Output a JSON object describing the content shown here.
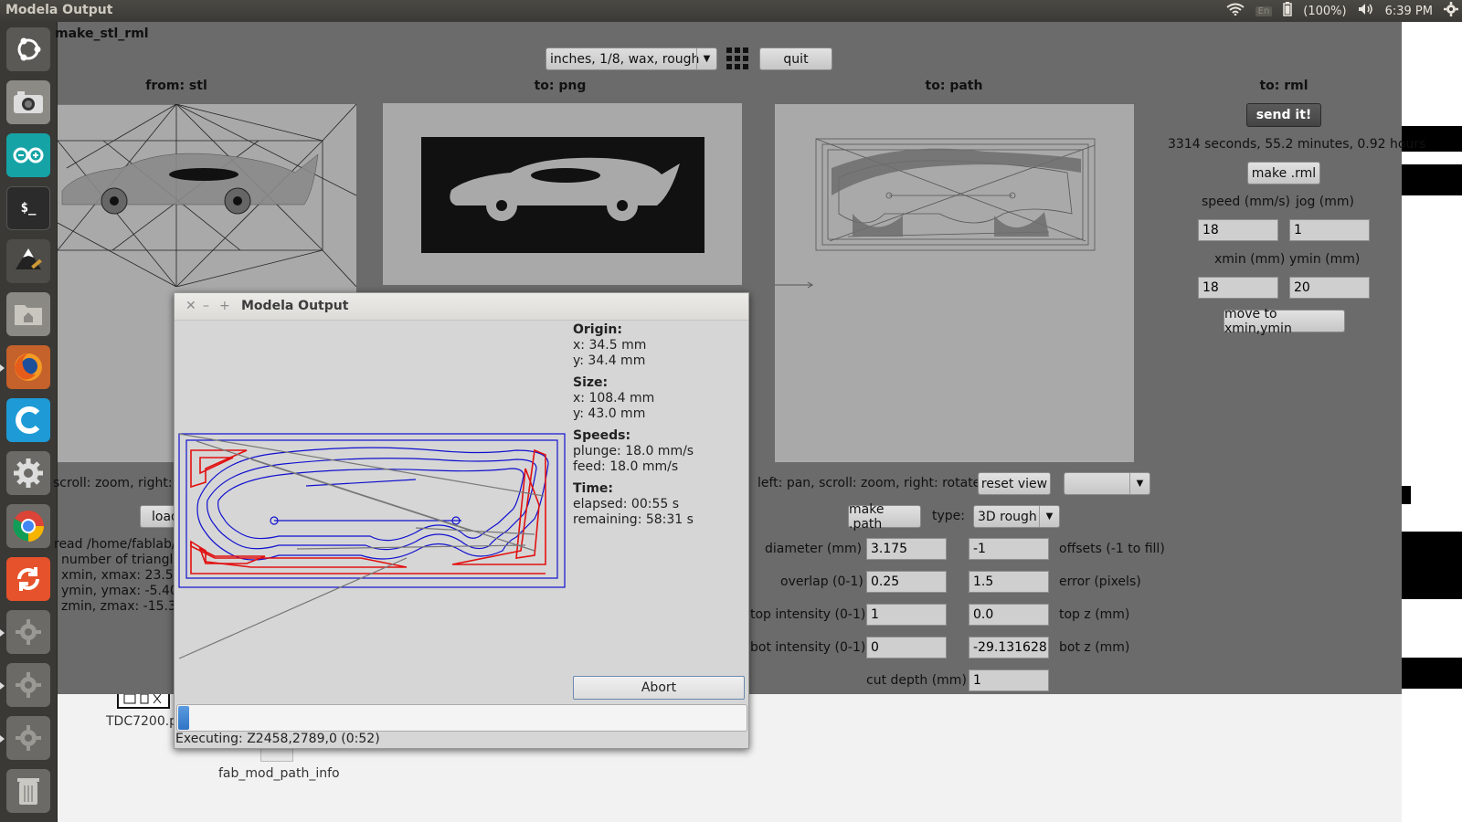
{
  "topbar": {
    "app_title": "Modela Output",
    "keyboard": "En",
    "battery": "(100%)",
    "time": "6:39 PM"
  },
  "launcher": {
    "items": [
      "ubuntu-dash",
      "camera",
      "arduino",
      "terminal",
      "inkscape",
      "files",
      "firefox",
      "cura",
      "system-settings",
      "chrome",
      "update",
      "settings",
      "settings",
      "settings",
      "trash"
    ]
  },
  "mainwin": {
    "title": "make_stl_rml",
    "profile_select": "inches, 1/8, wax, rough",
    "quit_label": "quit",
    "col_from": "from: stl",
    "col_png": "to: png",
    "col_path": "to: path",
    "col_rml": "to: rml",
    "left_hint": "scroll: zoom, right: rotate",
    "load_label": "load",
    "read_lines": [
      "read /home/fablab/...",
      "number of triangles",
      "xmin, xmax: 23.529",
      "ymin, ymax: -5.408",
      "zmin, zmax: -15.37"
    ],
    "path_hint": "left: pan, scroll: zoom, right: rotate",
    "reset_view": "reset view",
    "make_path": "make .path",
    "type_label": "type:",
    "type_value": "3D rough",
    "diameter_label": "diameter (mm)",
    "diameter_value": "3.175",
    "offsets_value": "-1",
    "offsets_label": "offsets (-1 to fill)",
    "overlap_label": "overlap (0-1)",
    "overlap_value": "0.25",
    "error_value": "1.5",
    "error_label": "error (pixels)",
    "top_int_label": "top intensity (0-1)",
    "top_int_value": "1",
    "topz_value": "0.0",
    "topz_label": "top z (mm)",
    "bot_int_label": "bot intensity (0-1)",
    "bot_int_value": "0",
    "botz_value": "-29.131628",
    "botz_label": "bot z (mm)",
    "cutdepth_label": "cut depth (mm)",
    "cutdepth_value": "1",
    "send_it": "send it!",
    "time_estimate": "3314 seconds, 55.2 minutes, 0.92 hours",
    "make_rml": "make .rml",
    "speed_label": "speed (mm/s)",
    "jog_label": "jog (mm)",
    "speed_value": "18",
    "jog_value": "1",
    "xmin_label": "xmin (mm)",
    "ymin_label": "ymin (mm)",
    "xmin_value": "18",
    "ymin_value": "20",
    "move_to": "move to xmin,ymin"
  },
  "desktop": {
    "icon1_label": "TDC7200.pn",
    "icon2_label": "fab_mod_path_info"
  },
  "dialog": {
    "title": "Modela Output",
    "origin_h": "Origin:",
    "origin_x": "x: 34.5 mm",
    "origin_y": "y: 34.4 mm",
    "size_h": "Size:",
    "size_x": "x: 108.4 mm",
    "size_y": "y: 43.0 mm",
    "speeds_h": "Speeds:",
    "plunge": "plunge: 18.0 mm/s",
    "feed": "feed: 18.0 mm/s",
    "time_h": "Time:",
    "elapsed": "elapsed: 00:55 s",
    "remaining": "remaining: 58:31 s",
    "abort": "Abort",
    "progress": 0.02,
    "status": "Executing: Z2458,2789,0 (0:52)"
  }
}
